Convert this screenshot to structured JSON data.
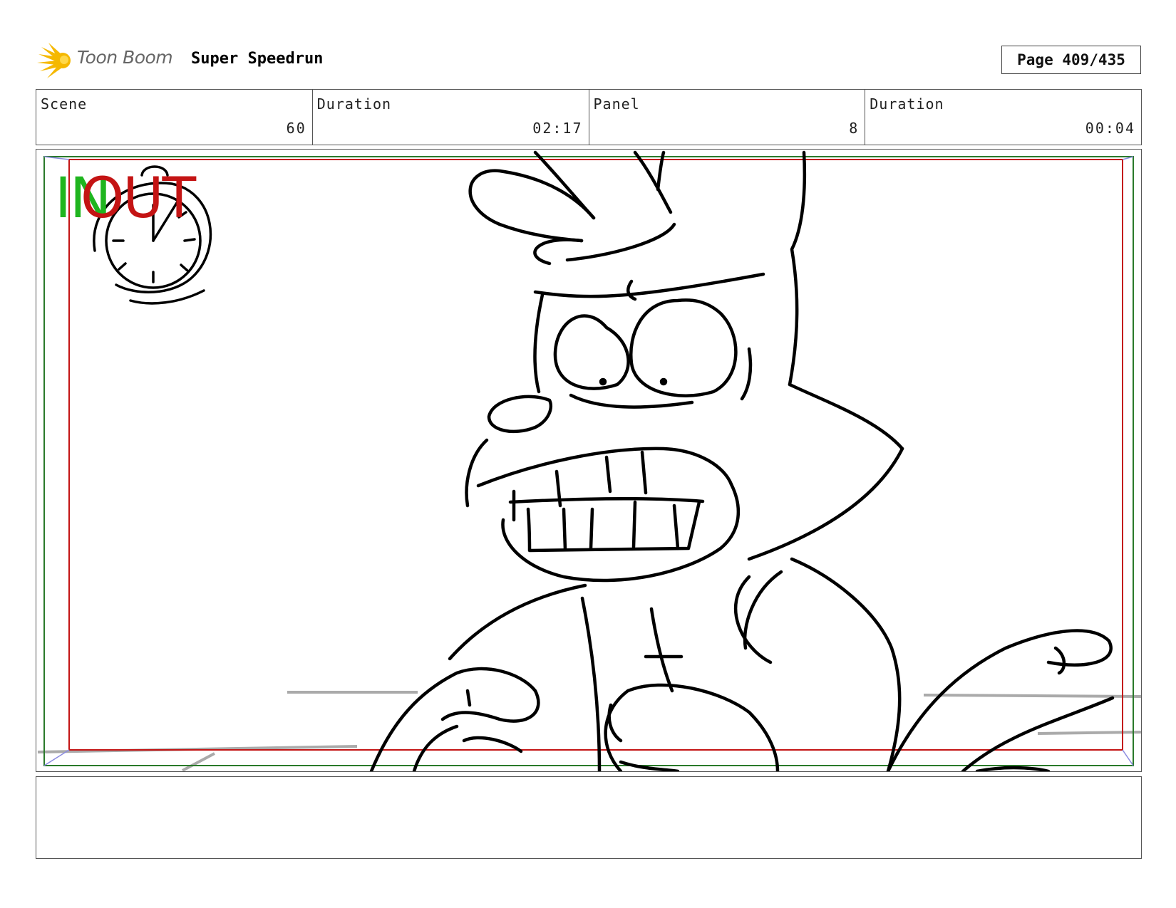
{
  "header": {
    "logo_text": "Toon Boom",
    "project_title": "Super Speedrun",
    "page_label": "Page 409/435"
  },
  "info": {
    "scene_label": "Scene",
    "scene_value": "60",
    "scene_duration_label": "Duration",
    "scene_duration_value": "02:17",
    "panel_label": "Panel",
    "panel_value": "8",
    "panel_duration_label": "Duration",
    "panel_duration_value": "00:04"
  },
  "panel": {
    "in_label": "IN",
    "out_label": "OUT",
    "colors": {
      "in": "#1fb51f",
      "out": "#c41414",
      "safe_frame": "#2a7a2a",
      "action_frame": "#c41414"
    }
  },
  "notes": {
    "text": ""
  }
}
